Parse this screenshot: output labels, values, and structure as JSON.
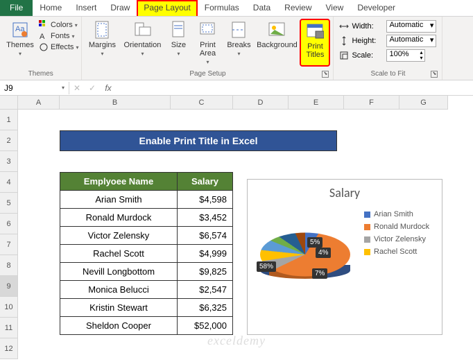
{
  "tabs": {
    "file": "File",
    "home": "Home",
    "insert": "Insert",
    "draw": "Draw",
    "page_layout": "Page Layout",
    "formulas": "Formulas",
    "data": "Data",
    "review": "Review",
    "view": "View",
    "developer": "Developer"
  },
  "ribbon": {
    "themes": {
      "label": "Themes",
      "themes_btn": "Themes",
      "colors": "Colors",
      "fonts": "Fonts",
      "effects": "Effects"
    },
    "page_setup": {
      "label": "Page Setup",
      "margins": "Margins",
      "orientation": "Orientation",
      "size": "Size",
      "print_area": "Print\nArea",
      "breaks": "Breaks",
      "background": "Background",
      "print_titles": "Print\nTitles"
    },
    "scale_to_fit": {
      "label": "Scale to Fit",
      "width": "Width:",
      "height": "Height:",
      "scale": "Scale:",
      "width_val": "Automatic",
      "height_val": "Automatic",
      "scale_val": "100%"
    }
  },
  "formula_bar": {
    "name_box": "J9",
    "formula": ""
  },
  "columns": [
    "A",
    "B",
    "C",
    "D",
    "E",
    "F",
    "G"
  ],
  "rows": [
    "1",
    "2",
    "3",
    "4",
    "5",
    "6",
    "7",
    "8",
    "9",
    "10",
    "11",
    "12"
  ],
  "selected_row": "9",
  "sheet": {
    "title": "Enable Print Title in Excel",
    "headers": {
      "name": "Emplyoee Name",
      "salary": "Salary"
    },
    "data": [
      {
        "name": "Arian Smith",
        "salary": "$4,598"
      },
      {
        "name": "Ronald Murdock",
        "salary": "$3,452"
      },
      {
        "name": "Victor Zelensky",
        "salary": "$6,574"
      },
      {
        "name": "Rachel Scott",
        "salary": "$4,999"
      },
      {
        "name": "Nevill Longbottom",
        "salary": "$9,825"
      },
      {
        "name": "Monica Belucci",
        "salary": "$2,547"
      },
      {
        "name": "Kristin Stewart",
        "salary": "$6,325"
      },
      {
        "name": "Sheldon Cooper",
        "salary": "$52,000"
      }
    ]
  },
  "chart_data": {
    "type": "pie",
    "title": "Salary",
    "categories": [
      "Arian Smith",
      "Ronald Murdock",
      "Victor Zelensky",
      "Rachel Scott",
      "Nevill Longbottom",
      "Monica Belucci",
      "Kristin Stewart",
      "Sheldon Cooper"
    ],
    "values": [
      4598,
      3452,
      6574,
      4999,
      9825,
      2547,
      6325,
      52000
    ],
    "labels_visible": [
      "58%",
      "7%",
      "5%",
      "4%"
    ],
    "legend_visible": [
      "Arian Smith",
      "Ronald Murdock",
      "Victor Zelensky",
      "Rachel Scott"
    ],
    "legend_colors": [
      "#4472c4",
      "#ed7d31",
      "#a5a5a5",
      "#ffc000"
    ]
  },
  "watermark": "exceldemy"
}
